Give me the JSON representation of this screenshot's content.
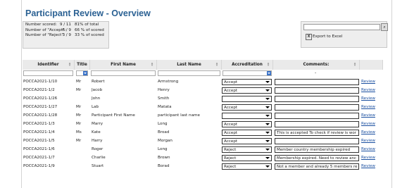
{
  "page": {
    "title": "Participant Review - Overview"
  },
  "stats": [
    {
      "label": "Number scored:",
      "count": "9 / 11",
      "percent": "81% of total"
    },
    {
      "label": "Number of \"Accept\":",
      "count": "6 / 9",
      "percent": "66 % of scored"
    },
    {
      "label": "Number of \"Reject\":",
      "count": "3 / 9",
      "percent": "33 % of scored"
    }
  ],
  "export": {
    "search_value": "",
    "export_label": "Export to Excel"
  },
  "columns": [
    {
      "label": "Identifier"
    },
    {
      "label": "Title"
    },
    {
      "label": "First Name"
    },
    {
      "label": "Last Name"
    },
    {
      "label": "Accreditation"
    },
    {
      "label": "Comments:"
    }
  ],
  "filters": {
    "comments_placeholder": "-"
  },
  "rows": [
    {
      "id": "POCCA2021-1/10",
      "title": "Mr",
      "first": "Robert",
      "last": "Armstrong",
      "accreditation": "Accept",
      "comment": "",
      "action": "Review"
    },
    {
      "id": "POCCA2021-1/2",
      "title": "Mr",
      "first": "Jacob",
      "last": "Henry",
      "accreditation": "Accept",
      "comment": "",
      "action": "Review"
    },
    {
      "id": "POCCA2021-1/26",
      "title": "",
      "first": "John",
      "last": "Smith",
      "accreditation": "",
      "comment": "",
      "action": "Review"
    },
    {
      "id": "POCCA2021-1/27",
      "title": "Mr",
      "first": "Lab",
      "last": "Matata",
      "accreditation": "Accept",
      "comment": "",
      "action": "Review"
    },
    {
      "id": "POCCA2021-1/28",
      "title": "Mr",
      "first": "Participant First Name",
      "last": "participant last name",
      "accreditation": "",
      "comment": "",
      "action": "Review"
    },
    {
      "id": "POCCA2021-1/3",
      "title": "Mr",
      "first": "Marry",
      "last": "Long",
      "accreditation": "Accept",
      "comment": "",
      "action": "Review"
    },
    {
      "id": "POCCA2021-1/4",
      "title": "Ms",
      "first": "Kate",
      "last": "Broad",
      "accreditation": "Accept",
      "comment": "This is accepted To check if review is wor",
      "action": "Review"
    },
    {
      "id": "POCCA2021-1/5",
      "title": "Mr",
      "first": "Harry",
      "last": "Morgan",
      "accreditation": "Accept",
      "comment": "",
      "action": "Review"
    },
    {
      "id": "POCCA2021-1/6",
      "title": "",
      "first": "Roger",
      "last": "Long",
      "accreditation": "Reject",
      "comment": "Member country membership expired",
      "action": "Review"
    },
    {
      "id": "POCCA2021-1/7",
      "title": "",
      "first": "Charlie",
      "last": "Brown",
      "accreditation": "Reject",
      "comment": "Membership  expired. Need to review anc",
      "action": "Review"
    },
    {
      "id": "POCCA2021-1/9",
      "title": "",
      "first": "Stuart",
      "last": "Borad",
      "accreditation": "Reject",
      "comment": "Not a member and already 5 members re",
      "action": "Review"
    }
  ],
  "colors": {
    "title": "#2b6193",
    "link": "#1a4fa0",
    "header_bg": "#eaeaea",
    "dropdown_arrow": "#3a73c9"
  }
}
